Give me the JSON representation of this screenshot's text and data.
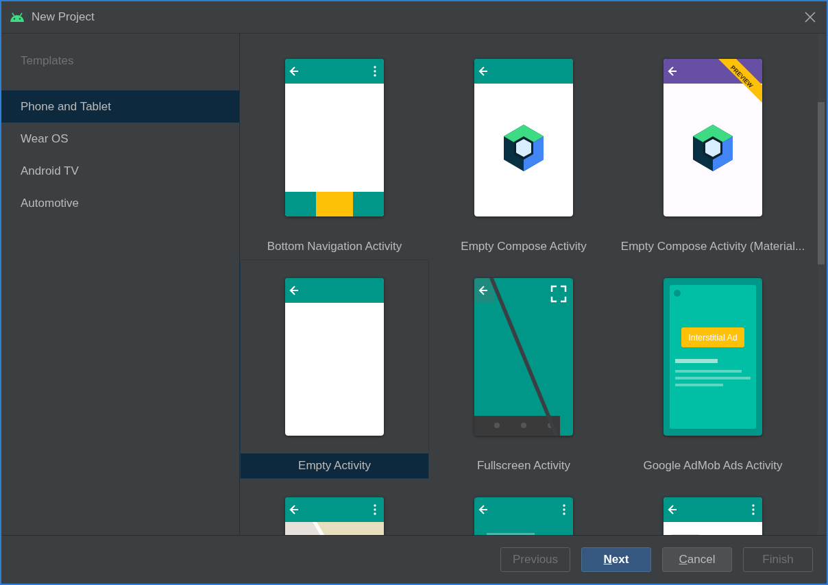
{
  "window": {
    "title": "New Project"
  },
  "sidebar": {
    "header": "Templates",
    "items": [
      {
        "label": "Phone and Tablet",
        "selected": true
      },
      {
        "label": "Wear OS",
        "selected": false
      },
      {
        "label": "Android TV",
        "selected": false
      },
      {
        "label": "Automotive",
        "selected": false
      }
    ]
  },
  "templates": [
    {
      "kind": "bottom-nav",
      "label": "Bottom Navigation Activity",
      "selected": false
    },
    {
      "kind": "compose",
      "label": "Empty Compose Activity",
      "selected": false
    },
    {
      "kind": "compose-material",
      "label": "Empty Compose Activity (Material...",
      "badge": "PREVIEW",
      "selected": false
    },
    {
      "kind": "empty",
      "label": "Empty Activity",
      "selected": true
    },
    {
      "kind": "fullscreen",
      "label": "Fullscreen Activity",
      "selected": false
    },
    {
      "kind": "ad",
      "label": "Google AdMob Ads Activity",
      "ad_label": "Interstitial Ad",
      "selected": false
    },
    {
      "kind": "map",
      "selected": false
    },
    {
      "kind": "teal-list",
      "selected": false
    },
    {
      "kind": "white-list",
      "selected": false
    }
  ],
  "buttons": [
    {
      "label": "Previous",
      "kind": "normal",
      "disabled": true,
      "mnemonic": false
    },
    {
      "label": "Next",
      "kind": "default",
      "disabled": false,
      "mnemonic": true
    },
    {
      "label": "Cancel",
      "kind": "normal",
      "disabled": false,
      "mnemonic": true
    },
    {
      "label": "Finish",
      "kind": "normal",
      "disabled": true,
      "mnemonic": false
    }
  ]
}
